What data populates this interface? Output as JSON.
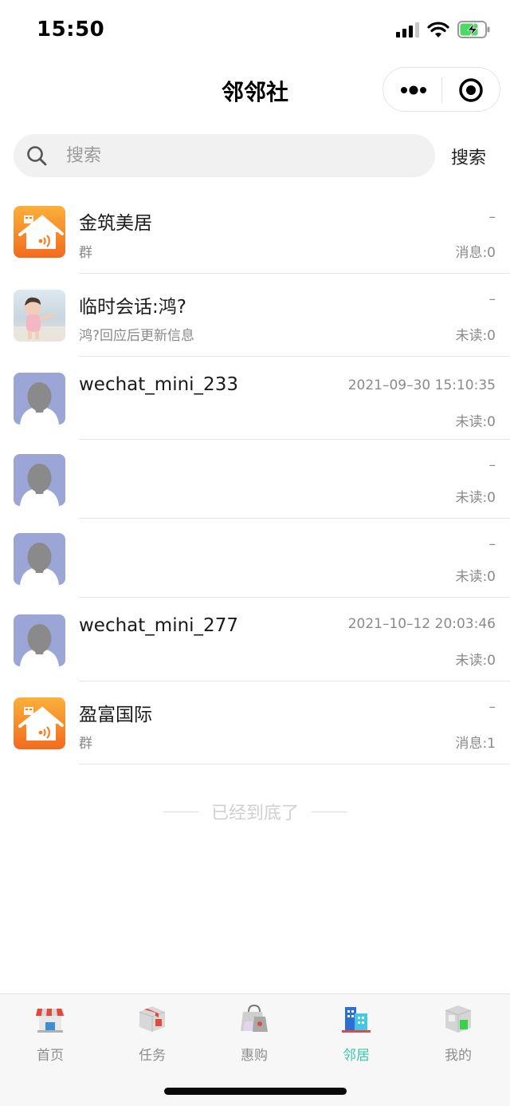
{
  "status_bar": {
    "time": "15:50"
  },
  "nav": {
    "title": "邻邻社"
  },
  "search": {
    "placeholder": "搜索",
    "value": "",
    "button_label": "搜索"
  },
  "conversations": [
    {
      "name": "金筑美居",
      "sub": "群",
      "time": "–",
      "count": "消息:0",
      "avatar": "house-wifi-icon"
    },
    {
      "name": "临时会话:鸿?",
      "sub": "鸿?回应后更新信息",
      "time": "–",
      "count": "未读:0",
      "avatar": "child-photo"
    },
    {
      "name": "wechat_mini_233",
      "sub": "",
      "time": "2021–09–30 15:10:35",
      "count": "未读:0",
      "avatar": "default-user-icon"
    },
    {
      "name": "",
      "sub": "",
      "time": "–",
      "count": "未读:0",
      "avatar": "default-user-icon"
    },
    {
      "name": "",
      "sub": "",
      "time": "–",
      "count": "未读:0",
      "avatar": "default-user-icon"
    },
    {
      "name": "wechat_mini_277",
      "sub": "",
      "time": "2021–10–12 20:03:46",
      "count": "未读:0",
      "avatar": "default-user-icon"
    },
    {
      "name": "盈富国际",
      "sub": "群",
      "time": "–",
      "count": "消息:1",
      "avatar": "house-wifi-icon"
    }
  ],
  "list_end_text": "已经到底了",
  "tabs": [
    {
      "label": "首页",
      "icon": "shop-icon",
      "active": false
    },
    {
      "label": "任务",
      "icon": "box-icon",
      "active": false
    },
    {
      "label": "惠购",
      "icon": "shopping-bag-icon",
      "active": false
    },
    {
      "label": "邻居",
      "icon": "buildings-icon",
      "active": true
    },
    {
      "label": "我的",
      "icon": "cube-icon",
      "active": false
    }
  ],
  "colors": {
    "accent": "#3cc6ae",
    "group_avatar": "#f6891a",
    "default_avatar": "#9ba6d6"
  }
}
